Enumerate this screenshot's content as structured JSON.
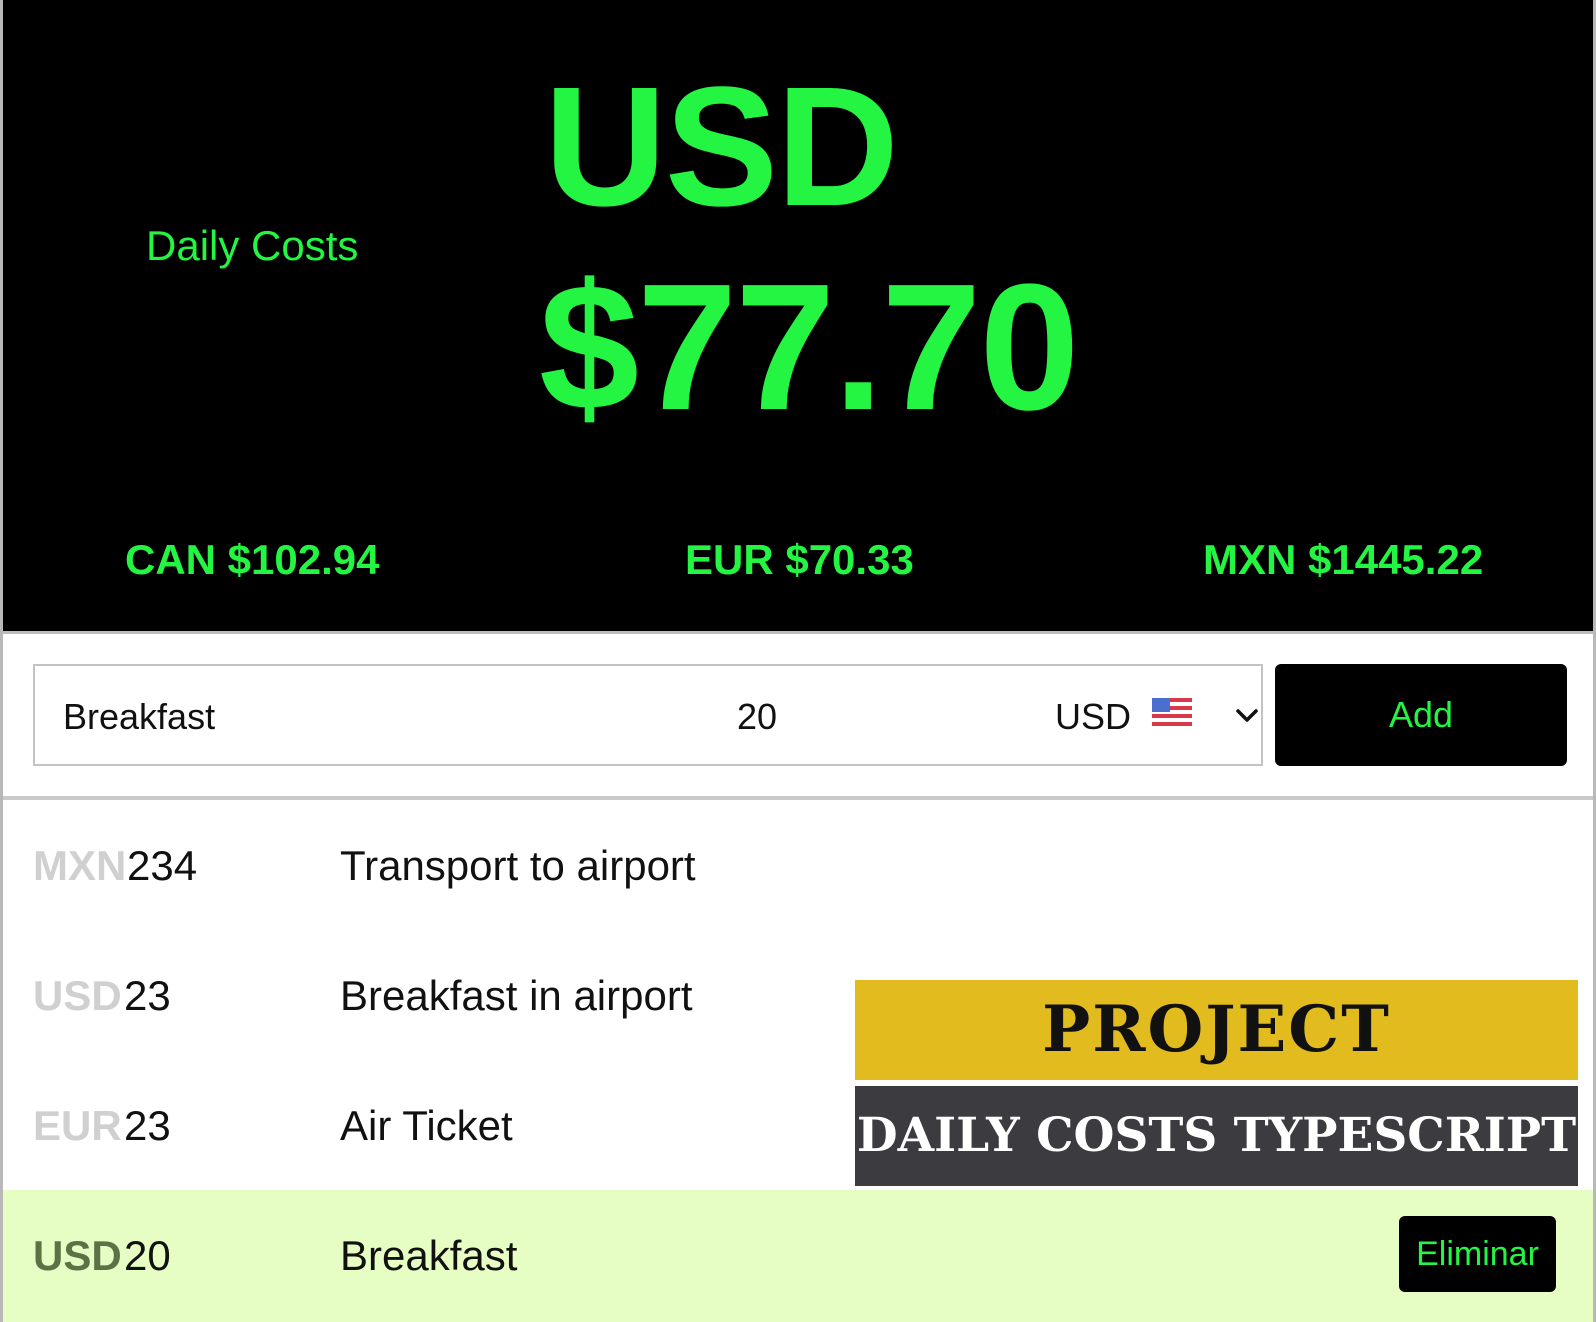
{
  "header": {
    "title": "Daily Costs",
    "currency_code": "USD",
    "total": "$77.70",
    "conversions": [
      {
        "label": "CAN $102.94"
      },
      {
        "label": "EUR $70.33"
      },
      {
        "label": "MXN $1445.22"
      }
    ],
    "accent_color": "#23f542"
  },
  "form": {
    "description_value": "Breakfast",
    "amount_value": "20",
    "currency_selected": "USD",
    "flag_icon": "us-flag-icon",
    "add_label": "Add"
  },
  "expenses": [
    {
      "currency": "MXN",
      "amount": "234",
      "description": "Transport to airport"
    },
    {
      "currency": "USD",
      "amount": "23",
      "description": "Breakfast in airport"
    },
    {
      "currency": "EUR",
      "amount": "23",
      "description": "Air Ticket"
    },
    {
      "currency": "USD",
      "amount": "20",
      "description": "Breakfast",
      "selected": true,
      "delete_label": "Eliminar"
    }
  ],
  "banner": {
    "line1": "PROJECT",
    "line2": "DAILY COSTS TYPESCRIPT",
    "line1_bg": "#e2bb1e",
    "line2_bg": "#3c3c40"
  }
}
